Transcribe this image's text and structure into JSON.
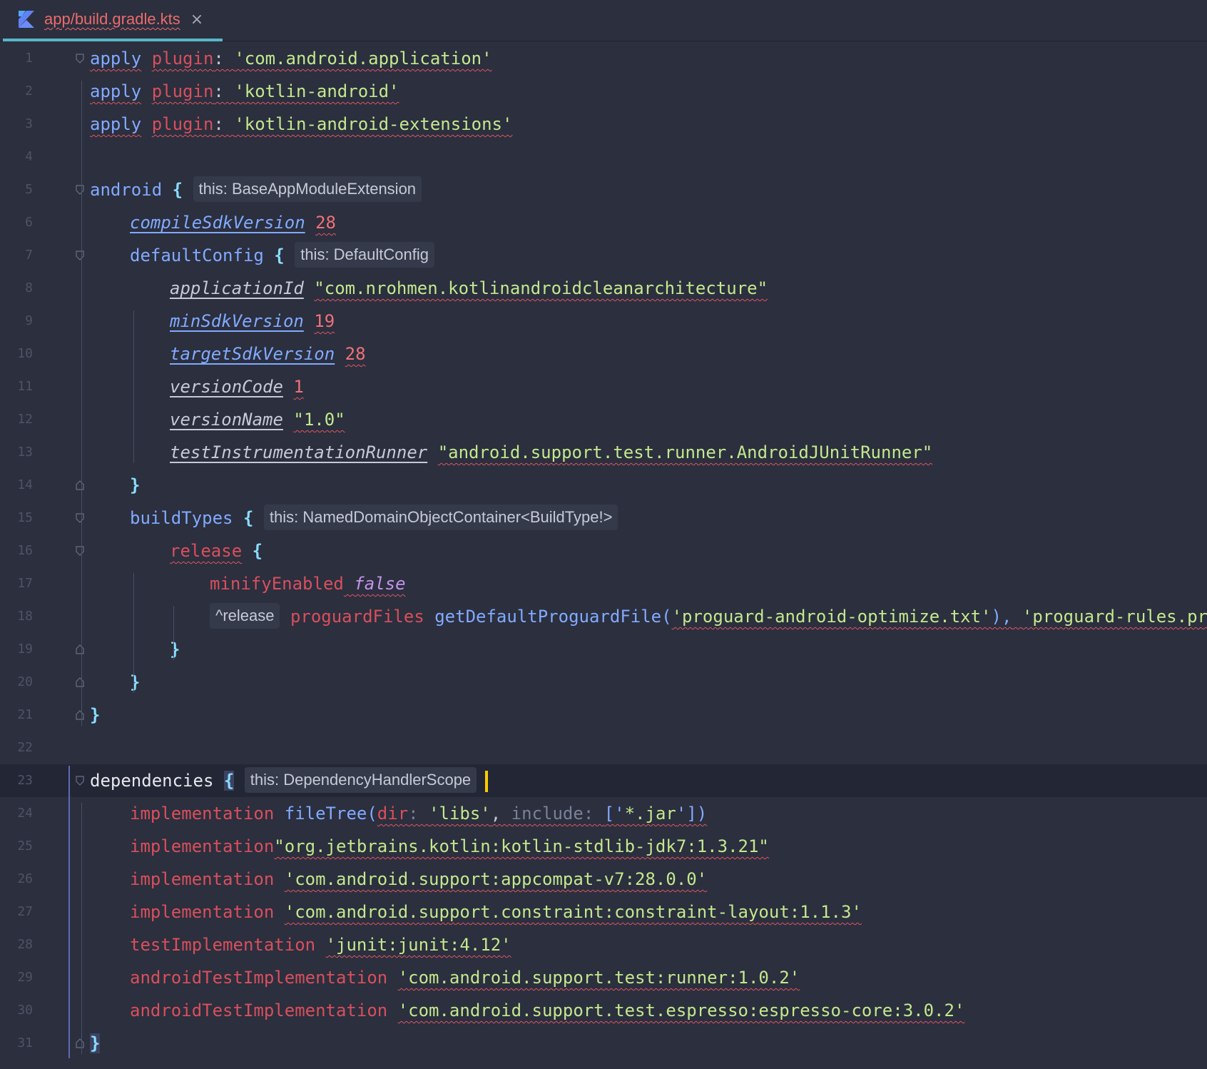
{
  "tab": {
    "file_name": "app/build.gradle.kts",
    "close_glyph": "×",
    "icon": "kotlin-icon"
  },
  "colors": {
    "background": "#2b2f3e",
    "current_line": "#232635",
    "function": "#82aaff",
    "keyword_red": "#d94f5c",
    "string": "#c3e88d",
    "number": "#f07178",
    "brace": "#89ddff",
    "caret": "#ffcc00",
    "tab_label": "#ec6b6b",
    "tab_underline": "#59b6c9"
  },
  "lines": [
    {
      "n": "1",
      "indent": 0,
      "fold": "open",
      "tokens": [
        [
          "fn",
          "apply",
          true
        ],
        [
          "plain",
          " "
        ],
        [
          "kw",
          "plugin",
          true
        ],
        [
          "plain",
          ": ",
          true
        ],
        [
          "str",
          "'com.android.application'",
          true
        ]
      ]
    },
    {
      "n": "2",
      "indent": 0,
      "tokens": [
        [
          "fn",
          "apply",
          true
        ],
        [
          "plain",
          " "
        ],
        [
          "kw",
          "plugin",
          true
        ],
        [
          "plain",
          ": ",
          true
        ],
        [
          "str",
          "'kotlin-android'",
          true
        ]
      ]
    },
    {
      "n": "3",
      "indent": 0,
      "tokens": [
        [
          "fn",
          "apply",
          true
        ],
        [
          "plain",
          " "
        ],
        [
          "kw",
          "plugin",
          true
        ],
        [
          "plain",
          ": ",
          true
        ],
        [
          "str",
          "'kotlin-android-extensions'",
          true
        ]
      ]
    },
    {
      "n": "4",
      "indent": 0,
      "tokens": []
    },
    {
      "n": "5",
      "indent": 0,
      "fold": "open",
      "tokens": [
        [
          "fn",
          "android"
        ],
        [
          "plain",
          " "
        ],
        [
          "brace",
          "{"
        ],
        [
          "plain",
          " "
        ],
        [
          "hint",
          "this: BaseAppModuleExtension"
        ]
      ]
    },
    {
      "n": "6",
      "indent": 1,
      "tokens": [
        [
          "propblue",
          "compileSdkVersion"
        ],
        [
          "plain",
          " "
        ],
        [
          "num",
          "28",
          true
        ]
      ]
    },
    {
      "n": "7",
      "indent": 1,
      "fold": "open",
      "tokens": [
        [
          "fn",
          "defaultConfig"
        ],
        [
          "plain",
          " "
        ],
        [
          "brace",
          "{"
        ],
        [
          "plain",
          " "
        ],
        [
          "hint",
          "this: DefaultConfig"
        ]
      ]
    },
    {
      "n": "8",
      "indent": 2,
      "tokens": [
        [
          "prop",
          "applicationId"
        ],
        [
          "plain",
          " "
        ],
        [
          "str",
          "\"com.nrohmen.kotlinandroidcleanarchitecture\"",
          true
        ]
      ]
    },
    {
      "n": "9",
      "indent": 2,
      "tokens": [
        [
          "propblue",
          "minSdkVersion"
        ],
        [
          "plain",
          " "
        ],
        [
          "num",
          "19",
          true
        ]
      ]
    },
    {
      "n": "10",
      "indent": 2,
      "tokens": [
        [
          "propblue",
          "targetSdkVersion"
        ],
        [
          "plain",
          " "
        ],
        [
          "num",
          "28",
          true
        ]
      ]
    },
    {
      "n": "11",
      "indent": 2,
      "tokens": [
        [
          "prop",
          "versionCode"
        ],
        [
          "plain",
          " "
        ],
        [
          "num",
          "1",
          true
        ]
      ]
    },
    {
      "n": "12",
      "indent": 2,
      "tokens": [
        [
          "prop",
          "versionName"
        ],
        [
          "plain",
          " "
        ],
        [
          "str",
          "\"1.0\"",
          true
        ]
      ]
    },
    {
      "n": "13",
      "indent": 2,
      "tokens": [
        [
          "prop",
          "testInstrumentationRunner"
        ],
        [
          "plain",
          " "
        ],
        [
          "str",
          "\"android.support.test.runner.AndroidJUnitRunner\"",
          true
        ]
      ]
    },
    {
      "n": "14",
      "indent": 1,
      "fold": "close",
      "tokens": [
        [
          "brace",
          "}"
        ]
      ]
    },
    {
      "n": "15",
      "indent": 1,
      "fold": "open",
      "tokens": [
        [
          "fn",
          "buildTypes"
        ],
        [
          "plain",
          " "
        ],
        [
          "brace",
          "{"
        ],
        [
          "plain",
          " "
        ],
        [
          "hint",
          "this: NamedDomainObjectContainer<BuildType!>"
        ]
      ]
    },
    {
      "n": "16",
      "indent": 2,
      "fold": "open",
      "tokens": [
        [
          "kw",
          "release",
          true
        ],
        [
          "plain",
          " "
        ],
        [
          "brace",
          "{"
        ]
      ]
    },
    {
      "n": "17",
      "indent": 3,
      "tokens": [
        [
          "kw",
          "minifyEnabled"
        ],
        [
          "plain",
          " ",
          true
        ],
        [
          "bool",
          "false",
          true
        ]
      ]
    },
    {
      "n": "18",
      "indent": 3,
      "tokens": [
        [
          "hint",
          "^release"
        ],
        [
          "plain",
          " "
        ],
        [
          "kw",
          "proguardFiles"
        ],
        [
          "plain",
          " "
        ],
        [
          "fn",
          "getDefaultProguardFile("
        ],
        [
          "str",
          "'proguard-android-optimize.txt'",
          true
        ],
        [
          "fn",
          "),",
          true
        ],
        [
          "plain",
          " ",
          true
        ],
        [
          "str",
          "'proguard-rules.pro'",
          true
        ]
      ]
    },
    {
      "n": "19",
      "indent": 2,
      "fold": "close",
      "tokens": [
        [
          "brace",
          "}"
        ]
      ]
    },
    {
      "n": "20",
      "indent": 1,
      "fold": "close",
      "tokens": [
        [
          "brace",
          "}"
        ]
      ]
    },
    {
      "n": "21",
      "indent": 0,
      "fold": "close",
      "tokens": [
        [
          "brace",
          "}"
        ]
      ]
    },
    {
      "n": "22",
      "indent": 0,
      "tokens": []
    },
    {
      "n": "23",
      "indent": 0,
      "fold": "open",
      "current": true,
      "tokens": [
        [
          "plainbright",
          "dependencies"
        ],
        [
          "plain",
          " "
        ],
        [
          "bracematch",
          "{"
        ],
        [
          "plain",
          " "
        ],
        [
          "hint",
          "this: DependencyHandlerScope"
        ],
        [
          "caret",
          ""
        ]
      ]
    },
    {
      "n": "24",
      "indent": 1,
      "tokens": [
        [
          "kw",
          "implementation"
        ],
        [
          "plain",
          " "
        ],
        [
          "fn",
          "fileTree("
        ],
        [
          "kw",
          "dir",
          true
        ],
        [
          "param",
          ": ",
          true
        ],
        [
          "str",
          "'libs'",
          true
        ],
        [
          "plain",
          ", ",
          true
        ],
        [
          "param",
          "include: ",
          true
        ],
        [
          "fn",
          "['",
          true
        ],
        [
          "str",
          "*.jar",
          true
        ],
        [
          "fn",
          "'])",
          true
        ]
      ]
    },
    {
      "n": "25",
      "indent": 1,
      "tokens": [
        [
          "kw",
          "implementation"
        ],
        [
          "str",
          "\"org.jetbrains.kotlin:kotlin-stdlib-jdk7:1.3.21\"",
          true
        ]
      ]
    },
    {
      "n": "26",
      "indent": 1,
      "tokens": [
        [
          "kw",
          "implementation"
        ],
        [
          "plain",
          " "
        ],
        [
          "str",
          "'com.android.support:appcompat-v7:28.0.0'",
          true
        ]
      ]
    },
    {
      "n": "27",
      "indent": 1,
      "tokens": [
        [
          "kw",
          "implementation"
        ],
        [
          "plain",
          " "
        ],
        [
          "str",
          "'com.android.support.constraint:constraint-layout:1.1.3'",
          true
        ]
      ]
    },
    {
      "n": "28",
      "indent": 1,
      "tokens": [
        [
          "kw",
          "testImplementation"
        ],
        [
          "plain",
          " "
        ],
        [
          "str",
          "'junit:junit:4.12'",
          true
        ]
      ]
    },
    {
      "n": "29",
      "indent": 1,
      "tokens": [
        [
          "kw",
          "androidTestImplementation"
        ],
        [
          "plain",
          " "
        ],
        [
          "str",
          "'com.android.support.test:runner:1.0.2'",
          true
        ]
      ]
    },
    {
      "n": "30",
      "indent": 1,
      "tokens": [
        [
          "kw",
          "androidTestImplementation"
        ],
        [
          "plain",
          " "
        ],
        [
          "str",
          "'com.android.support.test.espresso:espresso-core:3.0.2'",
          true
        ]
      ]
    },
    {
      "n": "31",
      "indent": 0,
      "fold": "close",
      "tokens": [
        [
          "bracematch",
          "}"
        ]
      ]
    }
  ]
}
